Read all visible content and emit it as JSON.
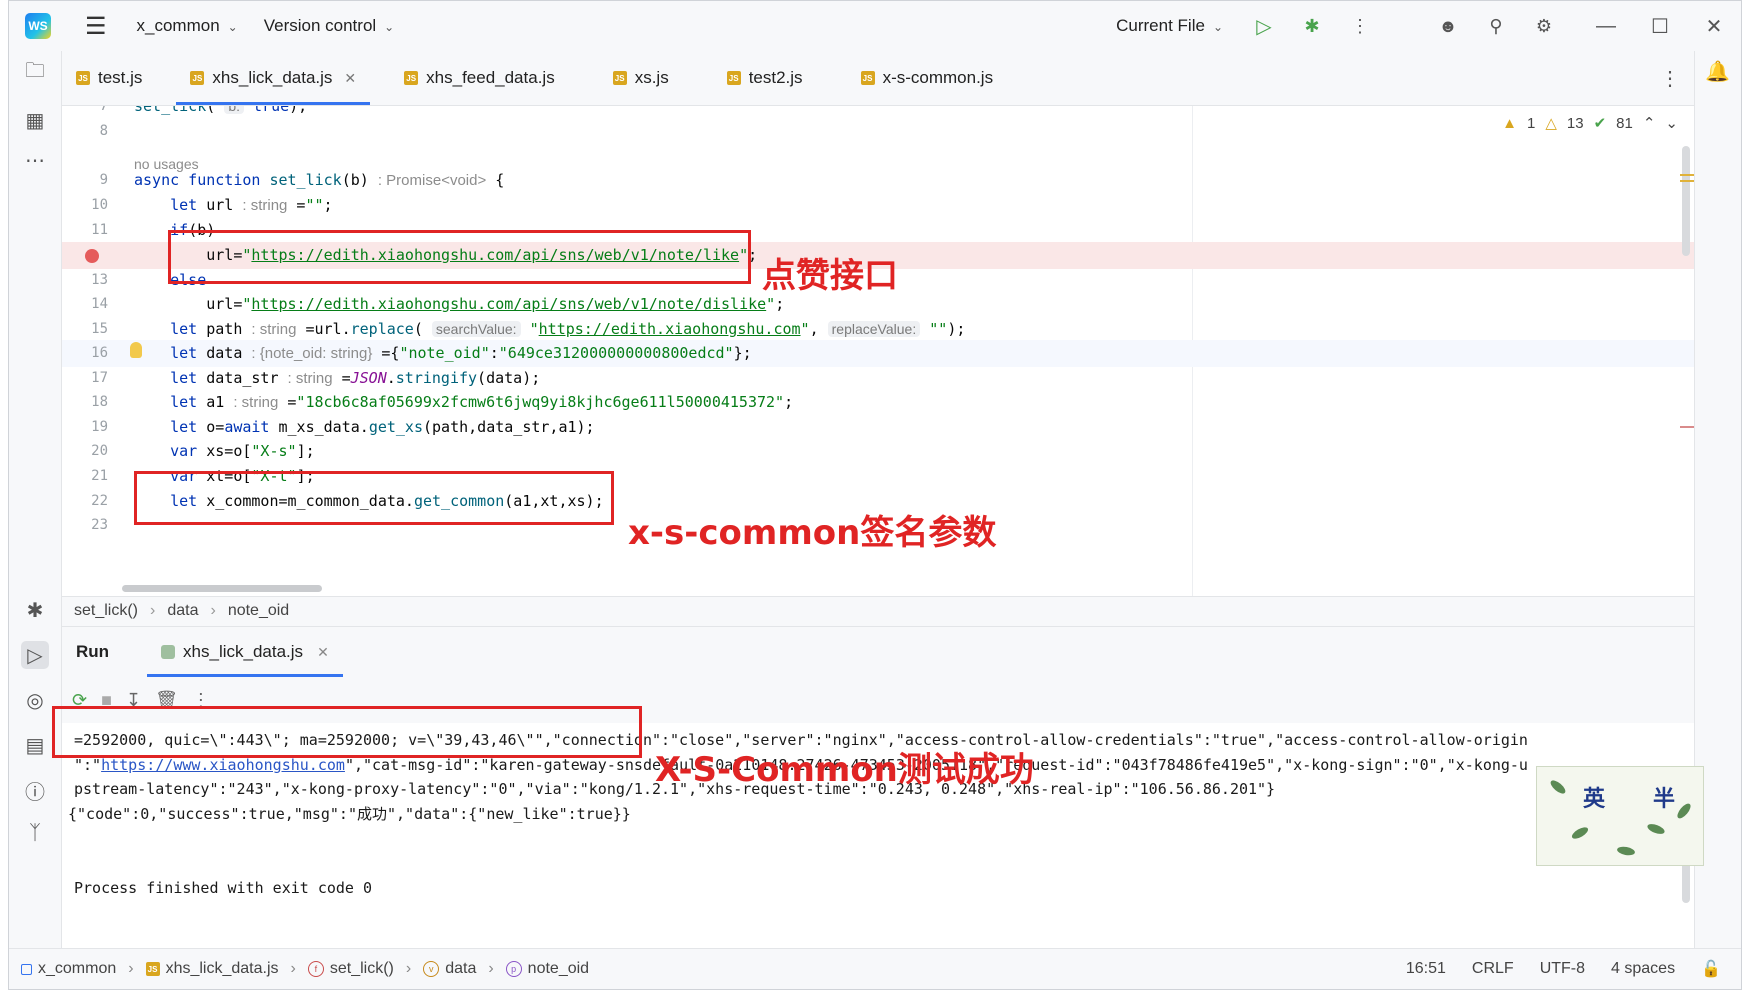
{
  "titlebar": {
    "project": "x_common",
    "vcs": "Version control",
    "run_config": "Current File"
  },
  "tabs": [
    {
      "label": "test.js",
      "active": false
    },
    {
      "label": "xhs_lick_data.js",
      "active": true
    },
    {
      "label": "xhs_feed_data.js",
      "active": false
    },
    {
      "label": "xs.js",
      "active": false
    },
    {
      "label": "test2.js",
      "active": false
    },
    {
      "label": "x-s-common.js",
      "active": false
    }
  ],
  "inspections": {
    "warnings": "1",
    "weak_warnings": "13",
    "ok": "81"
  },
  "editor": {
    "no_usages": "no usages",
    "lines": [
      {
        "no": "7",
        "html": "<span class=\"fn\">set_lick</span>( <span class=\"chip\">b:</span> <span class=\"kw\">true</span>);"
      },
      {
        "no": "8",
        "html": ""
      },
      {
        "no": "9",
        "html": "<span class=\"kw\">async function</span> <span class=\"fn\">set_lick</span>(b) <span class=\"hint\">: Promise&lt;void&gt;</span> {"
      },
      {
        "no": "10",
        "html": "    <span class=\"kw\">let</span> url <span class=\"hint\">: string</span> =<span class=\"str\">\"\"</span>;"
      },
      {
        "no": "11",
        "html": "    <span class=\"kw\">if</span>(b)"
      },
      {
        "no": "12",
        "html": "        url=<span class=\"str\">\"</span><span class=\"url\">https://edith.xiaohongshu.com/api/sns/web/v1/note/like</span><span class=\"str\">\"</span>;"
      },
      {
        "no": "13",
        "html": "    <span class=\"kw\">else</span>"
      },
      {
        "no": "14",
        "html": "        url=<span class=\"str\">\"</span><span class=\"url\">https://edith.xiaohongshu.com/api/sns/web/v1/note/dislike</span><span class=\"str\">\"</span>;"
      },
      {
        "no": "15",
        "html": "    <span class=\"kw\">let</span> path <span class=\"hint\">: string</span> =url.<span class=\"fn\">replace</span>( <span class=\"chip\">searchValue:</span> <span class=\"str\">\"</span><span class=\"url\">https://edith.xiaohongshu.com</span><span class=\"str\">\"</span>, <span class=\"chip\">replaceValue:</span> <span class=\"str\">\"\"</span>);"
      },
      {
        "no": "16",
        "html": "    <span class=\"kw\">let</span> data <span class=\"hint\">: {note_oid: string}</span> ={<span class=\"str\">\"note_oid\"</span>:<span class=\"str\">\"649ce312000000000800edcd\"</span>};"
      },
      {
        "no": "17",
        "html": "    <span class=\"kw\">let</span> data_str <span class=\"hint\">: string</span> =<span class=\"sp\">JSON</span>.<span class=\"fn\">stringify</span>(data);"
      },
      {
        "no": "18",
        "html": "    <span class=\"kw\">let</span> a1 <span class=\"hint\">: string</span> =<span class=\"str\">\"18cb6c8af05699x2fcmw6t6jwq9yi8kjhc6ge611l50000415372\"</span>;"
      },
      {
        "no": "19",
        "html": "    <span class=\"kw\">let</span> o=<span class=\"kw\">await</span> m_xs_data.<span class=\"fn\">get_xs</span>(path,data_str,a1);"
      },
      {
        "no": "20",
        "html": "    <span class=\"kw\">var</span> xs=o[<span class=\"str\">\"X-s\"</span>];"
      },
      {
        "no": "21",
        "html": "    <span class=\"kw\">var</span> xt=o[<span class=\"str\">\"X-t\"</span>];"
      },
      {
        "no": "22",
        "html": "    <span class=\"kw\">let</span> x_common=m_common_data.<span class=\"fn\">get_common</span>(a1,xt,xs);"
      },
      {
        "no": "23",
        "html": ""
      }
    ]
  },
  "breadcrumb": [
    "set_lick()",
    "data",
    "note_oid"
  ],
  "run": {
    "title": "Run",
    "tab": "xhs_lick_data.js"
  },
  "console": {
    "line1": "=2592000, quic=\\\":443\\\"; ma=2592000; v=\\\"39,43,46\\\"\",\"connection\":\"close\",\"server\":\"nginx\",\"access-control-allow-credentials\":\"true\",\"access-control-allow-origin",
    "line2_pre": "\":\"",
    "line2_link": "https://www.xiaohongshu.com",
    "line2_post": "\",\"cat-msg-id\":\"karen-gateway-snsdefault-0a210148.27426-473453-2005118\",\"request-id\":\"043f78486fe419e5\",\"x-kong-sign\":\"0\",\"x-kong-u",
    "line3": "pstream-latency\":\"243\",\"x-kong-proxy-latency\":\"0\",\"via\":\"kong/1.2.1\",\"xhs-request-time\":\"0.243, 0.248\",\"xhs-real-ip\":\"106.56.86.201\"}",
    "line4": "{\"code\":0,\"success\":true,\"msg\":\"成功\",\"data\":{\"new_like\":true}}",
    "line5": "Process finished with exit code 0"
  },
  "annotations": {
    "like_api": "点赞接口",
    "xs_common_param": "x-s-common签名参数",
    "success": "X-S-Common测试成功"
  },
  "stamp": {
    "text1": "英",
    "text2": "半"
  },
  "statusbar": {
    "project": "x_common",
    "file": "xhs_lick_data.js",
    "func": "set_lick()",
    "var": "data",
    "prop": "note_oid",
    "position": "16:51",
    "line_sep": "CRLF",
    "encoding": "UTF-8",
    "indent": "4 spaces"
  },
  "colors": {
    "accent": "#3574f0",
    "annotation": "#e02424",
    "breakpoint": "#e55b5b"
  }
}
